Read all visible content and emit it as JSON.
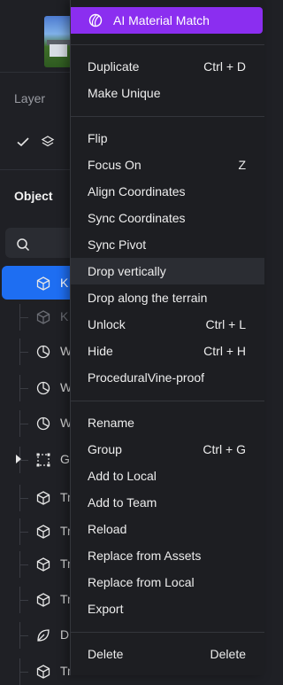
{
  "left_panel": {
    "layer_label": "Layer",
    "object_label": "Object",
    "tree_rows": [
      {
        "label": "K",
        "icon": "cube-icon"
      },
      {
        "label": "K",
        "icon": "cube-icon"
      },
      {
        "label": "W",
        "icon": "pie-icon"
      },
      {
        "label": "W",
        "icon": "pie-icon"
      },
      {
        "label": "W",
        "icon": "pie-icon"
      },
      {
        "label": "G",
        "icon": "group-icon"
      },
      {
        "label": "Tr",
        "icon": "cube-icon"
      },
      {
        "label": "Tr",
        "icon": "cube-icon"
      },
      {
        "label": "Tr",
        "icon": "cube-icon"
      },
      {
        "label": "Tr",
        "icon": "cube-icon"
      },
      {
        "label": "D",
        "icon": "leaf-icon"
      },
      {
        "label": "Tr",
        "icon": "cube-icon"
      }
    ]
  },
  "menu": {
    "ai_button": "AI Material Match",
    "groups": [
      [
        {
          "label": "Duplicate",
          "shortcut": "Ctrl + D"
        },
        {
          "label": "Make Unique",
          "shortcut": ""
        }
      ],
      [
        {
          "label": "Flip",
          "shortcut": ""
        },
        {
          "label": "Focus On",
          "shortcut": "Z"
        },
        {
          "label": "Align Coordinates",
          "shortcut": ""
        },
        {
          "label": "Sync Coordinates",
          "shortcut": ""
        },
        {
          "label": "Sync Pivot",
          "shortcut": ""
        },
        {
          "label": "Drop vertically",
          "shortcut": ""
        },
        {
          "label": "Drop along the terrain",
          "shortcut": ""
        },
        {
          "label": "Unlock",
          "shortcut": "Ctrl + L"
        },
        {
          "label": "Hide",
          "shortcut": "Ctrl + H"
        },
        {
          "label": "ProceduralVine-proof",
          "shortcut": ""
        }
      ],
      [
        {
          "label": "Rename",
          "shortcut": ""
        },
        {
          "label": "Group",
          "shortcut": "Ctrl + G"
        },
        {
          "label": "Add to Local",
          "shortcut": ""
        },
        {
          "label": "Add to Team",
          "shortcut": ""
        },
        {
          "label": "Reload",
          "shortcut": ""
        },
        {
          "label": "Replace from Assets",
          "shortcut": ""
        },
        {
          "label": "Replace from Local",
          "shortcut": ""
        },
        {
          "label": "Export",
          "shortcut": ""
        }
      ],
      [
        {
          "label": "Delete",
          "shortcut": "Delete"
        }
      ]
    ],
    "highlighted_item": "Drop vertically"
  },
  "colors": {
    "accent": "#8b2ef0",
    "selection": "#1e6ef2",
    "menu_bg": "#1d1e22"
  }
}
